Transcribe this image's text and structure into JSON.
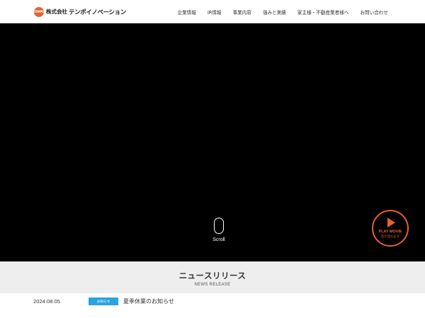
{
  "header": {
    "logo": {
      "mark_text": "TEMPO",
      "corp": "株式会社",
      "name": "テンポイノベーション"
    },
    "nav": [
      {
        "label": "企業情報"
      },
      {
        "label": "IR情報"
      },
      {
        "label": "事業内容"
      },
      {
        "label": "強みと実績"
      },
      {
        "label": "家主様・不動産業者様へ"
      },
      {
        "label": "お問い合わせ"
      }
    ]
  },
  "hero": {
    "scroll_label": "Scroll",
    "play": {
      "label": "PLAY MOVIE",
      "sub": "音が流れます"
    }
  },
  "news": {
    "title": "ニュースリリース",
    "subtitle": "NEWS RELEASE",
    "items": [
      {
        "date": "2024.08.05",
        "category": "お知らせ",
        "text": "夏季休業のお知らせ"
      }
    ]
  },
  "colors": {
    "accent": "#e8602a",
    "badge": "#2aa3e0",
    "hero_bg": "#000000",
    "news_header_bg": "#eeeeee"
  }
}
